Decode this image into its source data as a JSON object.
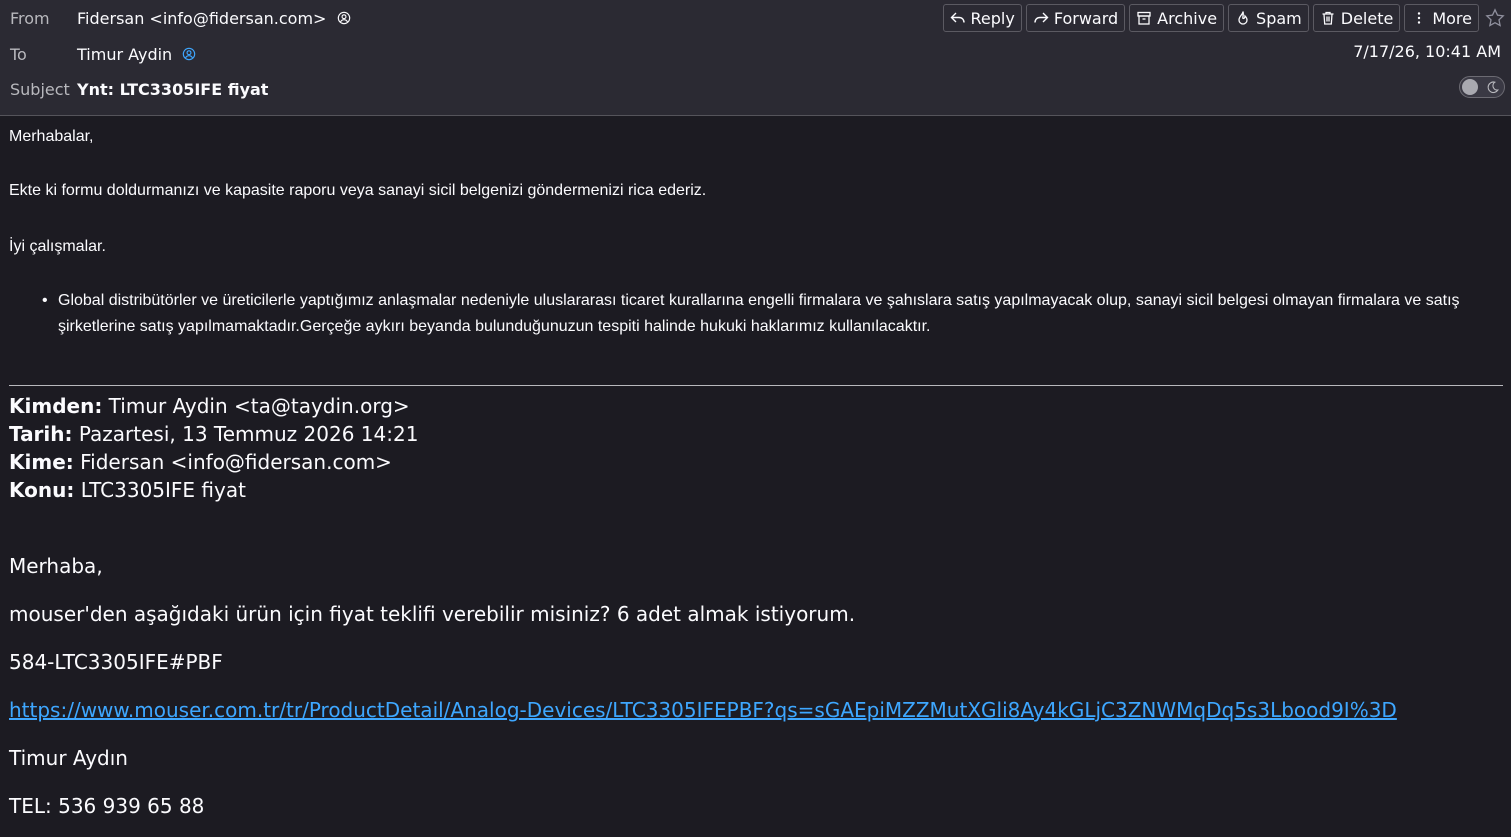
{
  "header": {
    "from_label": "From",
    "from_value": "Fidersan <info@fidersan.com>",
    "to_label": "To",
    "to_value": "Timur Aydin",
    "subject_label": "Subject",
    "subject_value": "Ynt: LTC3305IFE fiyat",
    "date": "7/17/26, 10:41 AM",
    "accent_color": "#3ea7ff"
  },
  "toolbar": {
    "reply": "Reply",
    "forward": "Forward",
    "archive": "Archive",
    "spam": "Spam",
    "delete": "Delete",
    "more": "More"
  },
  "message": {
    "greeting": "Merhabalar,",
    "line1": "Ekte ki formu doldurmanızı ve kapasite raporu veya sanayi sicil belgenizi göndermenizi rica ederiz.",
    "closing": "İyi çalışmalar.",
    "bullet": "Global distribütörler ve üreticilerle yaptığımız anlaşmalar nedeniyle uluslararası ticaret kurallarına engelli firmalara ve şahıslara satış yapılmayacak olup, sanayi sicil belgesi olmayan firmalara ve satış şirketlerine satış yapılmamaktadır.Gerçeğe aykırı beyanda bulunduğunuzun tespiti halinde hukuki haklarımız kullanılacaktır."
  },
  "quoted": {
    "from_label": "Kimden:",
    "from_value": " Timur Aydin <ta@taydin.org>",
    "date_label": "Tarih:",
    "date_value": " Pazartesi, 13 Temmuz 2026 14:21",
    "to_label": "Kime:",
    "to_value": " Fidersan <info@fidersan.com>",
    "subject_label": "Konu:",
    "subject_value": " LTC3305IFE fiyat",
    "greeting": "Merhaba,",
    "request": "mouser'den aşağıdaki ürün için fiyat teklifi verebilir misiniz? 6 adet almak istiyorum.",
    "part": "584-LTC3305IFE#PBF",
    "link": "https://www.mouser.com.tr/tr/ProductDetail/Analog-Devices/LTC3305IFEPBF?qs=sGAEpiMZZMutXGli8Ay4kGLjC3ZNWMqDq5s3Lbood9I%3D",
    "signature": "Timur Aydın",
    "phone": "TEL: 536 939 65 88"
  }
}
